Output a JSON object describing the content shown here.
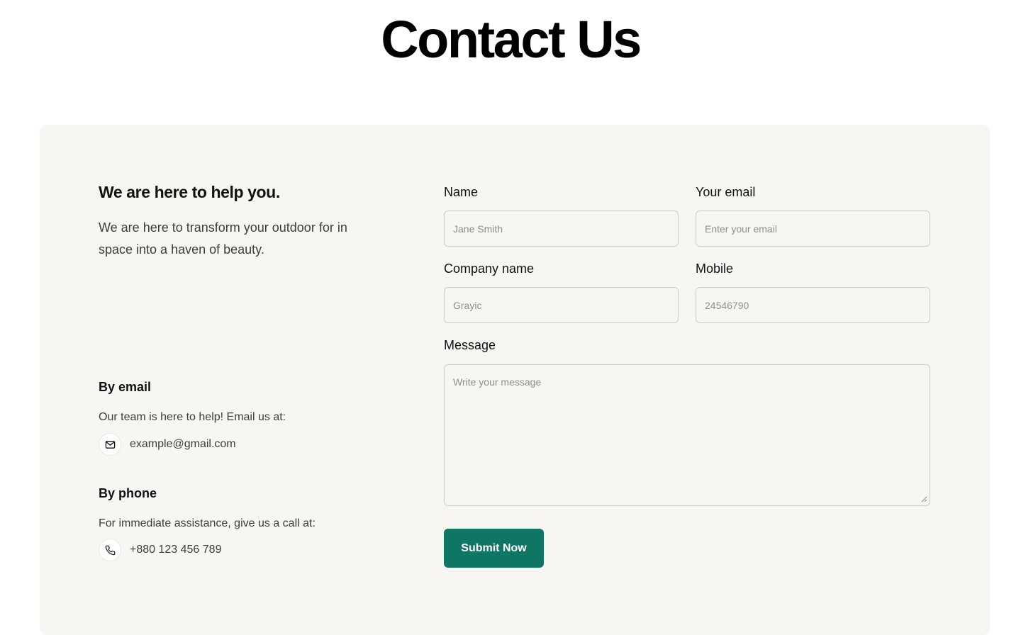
{
  "header": {
    "title": "Contact Us"
  },
  "info": {
    "heading": "We are here to help you.",
    "text": "We are here to transform your outdoor for in space into a haven of beauty.",
    "email_section": {
      "heading": "By email",
      "text": "Our team is here to help! Email us at:",
      "icon": "mail-icon",
      "value": "example@gmail.com"
    },
    "phone_section": {
      "heading": "By phone",
      "text": "For immediate assistance, give us a call at:",
      "icon": "phone-icon",
      "value": "+880 123 456 789"
    }
  },
  "form": {
    "name": {
      "label": "Name",
      "placeholder": "Jane Smith",
      "value": ""
    },
    "email": {
      "label": "Your email",
      "placeholder": "Enter your email",
      "value": ""
    },
    "company": {
      "label": "Company name",
      "placeholder": "Grayic",
      "value": ""
    },
    "mobile": {
      "label": "Mobile",
      "placeholder": "24546790",
      "value": ""
    },
    "message": {
      "label": "Message",
      "placeholder": "Write your message",
      "value": ""
    },
    "submit_label": "Submit Now"
  },
  "colors": {
    "panel_background": "#f8f6f2",
    "accent": "#0f7663",
    "input_border": "#cfccc6",
    "body_text": "#3d3d3d"
  }
}
